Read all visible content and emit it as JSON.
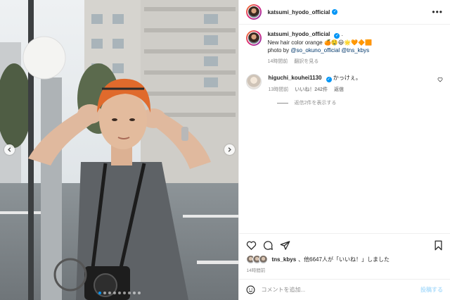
{
  "header": {
    "username": "katsumi_hyodo_official",
    "verified_icon": "verified-badge-icon",
    "more_icon": "more-options-icon"
  },
  "caption": {
    "username": "katsumi_hyodo_official",
    "separator": ".",
    "line1": "New hair color orange 🍊🤤😃🌟🧡🔶🟧",
    "line2_prefix": "photo by ",
    "mention1": "@so_okuno_official",
    "mention2": "@tns_kbys",
    "time": "14時間前",
    "translate": "翻訳を見る"
  },
  "comment": {
    "username": "higuchi_kouhei1130",
    "text": "かっけぇ。",
    "time": "13時間前",
    "likes": "いいね！242件",
    "reply": "返信",
    "view_replies": "返信2件を表示する"
  },
  "likes": {
    "username": "tns_kbys",
    "text": "、他6647人が「いいね！」しました",
    "time": "14時間前"
  },
  "add_comment": {
    "placeholder": "コメントを追加...",
    "post": "投稿する"
  },
  "carousel": {
    "slide_count": 9,
    "active_index": 0
  },
  "colors": {
    "accent": "#0095f6",
    "link": "#00376b",
    "muted": "#8e8e8e",
    "post_disabled": "#b2dffc"
  }
}
